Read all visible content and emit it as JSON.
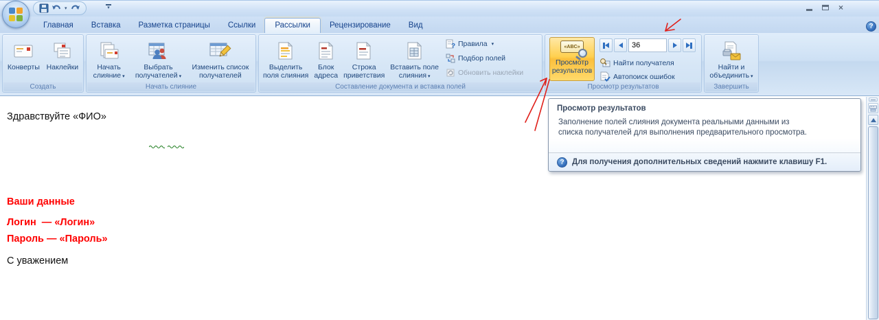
{
  "window": {
    "close_glyph": "×",
    "help_glyph": "?"
  },
  "tabs": [
    {
      "label": "Главная"
    },
    {
      "label": "Вставка"
    },
    {
      "label": "Разметка страницы"
    },
    {
      "label": "Ссылки"
    },
    {
      "label": "Рассылки",
      "active": true
    },
    {
      "label": "Рецензирование"
    },
    {
      "label": "Вид"
    }
  ],
  "icons": {
    "dropdown_caret": "▾",
    "abc_badge": "«ABC»"
  },
  "ribbon": {
    "groups": {
      "create": {
        "caption": "Создать",
        "envelopes": "Конверты",
        "labels": "Наклейки"
      },
      "start": {
        "caption": "Начать слияние",
        "start_merge": [
          "Начать",
          "слияние"
        ],
        "select_recipients": [
          "Выбрать",
          "получателей"
        ],
        "edit_list": [
          "Изменить список",
          "получателей"
        ]
      },
      "compose": {
        "caption": "Составление документа и вставка полей",
        "highlight_fields": [
          "Выделить",
          "поля слияния"
        ],
        "address_block": [
          "Блок",
          "адреса"
        ],
        "greeting_line": [
          "Строка",
          "приветствия"
        ],
        "insert_field": [
          "Вставить поле",
          "слияния"
        ],
        "rules": "Правила",
        "match_fields": "Подбор полей",
        "update_labels": "Обновить наклейки"
      },
      "preview": {
        "caption": "Просмотр результатов",
        "preview_results": [
          "Просмотр",
          "результатов"
        ],
        "record_value": "36",
        "find_recipient": "Найти получателя",
        "auto_check": "Автопоиск ошибок"
      },
      "finish": {
        "caption": "Завершить",
        "finish_merge": [
          "Найти и",
          "объединить"
        ]
      }
    }
  },
  "tooltip": {
    "title": "Просмотр результатов",
    "body": "Заполнение полей слияния документа реальными данными из списка получателей для выполнения предварительного просмотра.",
    "footer": "Для получения дополнительных сведений нажмите клавишу F1."
  },
  "document": {
    "greeting": "Здравствуйте «ФИО»",
    "heading": "Ваши данные",
    "login": "Логин  — «Логин»",
    "password": "Пароль — «Пароль»",
    "closing": "С уважением"
  },
  "colors": {
    "accent_orange": "#FFD04E",
    "tab_text": "#15428B",
    "red_text": "#FF0000",
    "squiggle_green": "#008000"
  }
}
